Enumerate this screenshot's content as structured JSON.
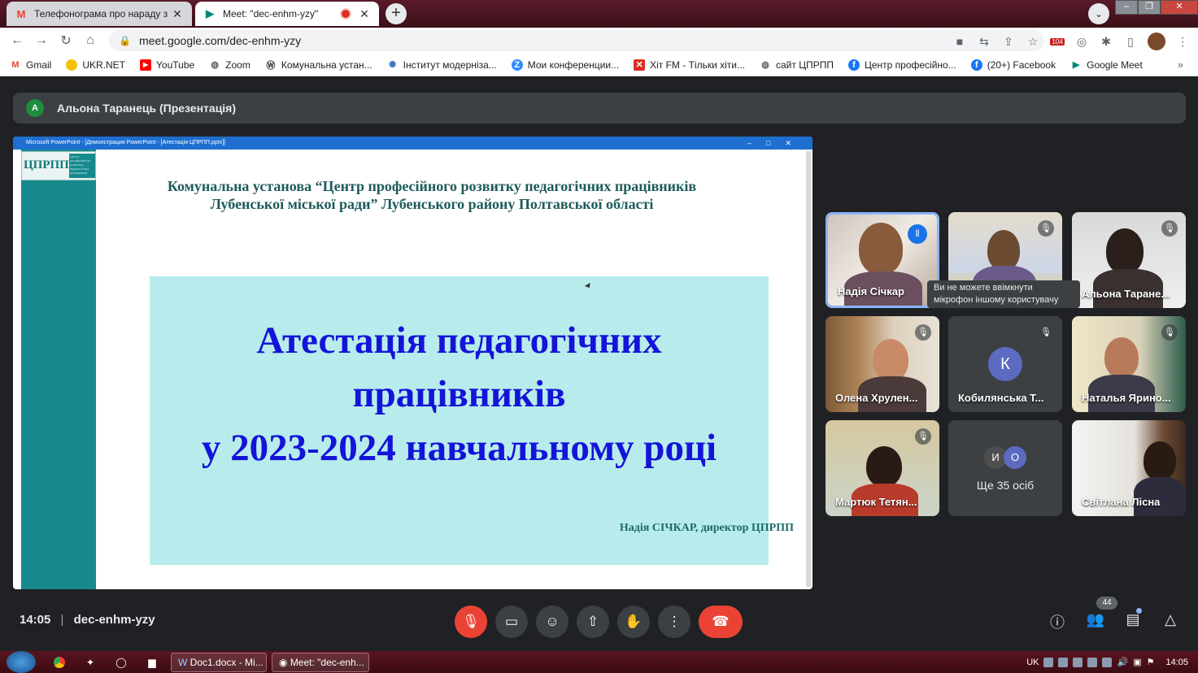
{
  "browser": {
    "tabs": [
      {
        "title": "Телефонограма про нараду з пи",
        "icon": "gmail-icon",
        "active": false
      },
      {
        "title": "Meet: \"dec-enhm-yzy\"",
        "icon": "google-meet-icon",
        "active": true
      }
    ],
    "url": "meet.google.com/dec-enhm-yzy",
    "calendar_badge": "104",
    "bookmarks": [
      {
        "label": "Gmail",
        "icon": "gmail-icon",
        "color": "#ea4335"
      },
      {
        "label": "UKR.NET",
        "icon": "ukrnet-icon",
        "color": "#f4c20d"
      },
      {
        "label": "YouTube",
        "icon": "youtube-icon",
        "color": "#ff0000"
      },
      {
        "label": "Zoom",
        "icon": "globe-icon",
        "color": "#5f6368"
      },
      {
        "label": "Комунальна устан...",
        "icon": "wordpress-icon",
        "color": "#333333"
      },
      {
        "label": "Інститут модерніза...",
        "icon": "imzo-icon",
        "color": "#3b78c4"
      },
      {
        "label": "Мои конференции...",
        "icon": "zoom-icon",
        "color": "#2d8cff"
      },
      {
        "label": "Хіт FM - Тільки хіти...",
        "icon": "hitfm-icon",
        "color": "#d93025"
      },
      {
        "label": "сайт ЦПРПП",
        "icon": "globe-icon",
        "color": "#5f6368"
      },
      {
        "label": "Центр професійно...",
        "icon": "facebook-icon",
        "color": "#1877f2"
      },
      {
        "label": "(20+) Facebook",
        "icon": "facebook-icon",
        "color": "#1877f2"
      },
      {
        "label": "Google Meet",
        "icon": "google-meet-icon",
        "color": "#00897b"
      }
    ],
    "bookmarks_more": "»"
  },
  "meet": {
    "presenter_initial": "А",
    "presenter_label": "Альона Таранець (Презентація)",
    "slide": {
      "window_title": "Microsoft PowerPoint - [Демонстрация PowerPoint - [Атестація ЦПРПП.pptx]]",
      "logo_text": "ЦПРПП",
      "logo_small": "Центр професійного розвитку педагогічних працівників",
      "header_line1": "Комунальна установа “Центр професійного розвитку педагогічних працівників",
      "header_line2": "Лубенської міської ради” Лубенського району Полтавської області",
      "main_line1": "Атестація педагогічних",
      "main_line2": "працівників",
      "main_line3": "у 2023-2024 навчальному році",
      "signature": "Надія СІЧКАР, директор ЦПРПП"
    },
    "participants": [
      {
        "name": "Надія Січкар",
        "speaking": true
      },
      {
        "name": "",
        "muted": true
      },
      {
        "name": "Альона Таране...",
        "muted": true
      },
      {
        "name": "Олена Хрулен...",
        "muted": true
      },
      {
        "name": "Кобилянська Т...",
        "muted": true,
        "initial": "К"
      },
      {
        "name": "Наталья Ярино...",
        "muted": true
      },
      {
        "name": "Мартюк Тетян...",
        "muted": true
      },
      {
        "name": "Ще 35 осіб",
        "initials": [
          "И",
          "О"
        ]
      },
      {
        "name": "Світлана Лісна"
      }
    ],
    "tooltip": "Ви не можете ввімкнути мікрофон іншому користувачу",
    "time": "14:05",
    "separator": "|",
    "meeting_code": "dec-enhm-yzy",
    "people_count": "44"
  },
  "taskbar": {
    "tasks": [
      "Doc1.docx - Mi...",
      "Meet: \"dec-enh..."
    ],
    "lang": "UK",
    "clock": "14:05"
  }
}
